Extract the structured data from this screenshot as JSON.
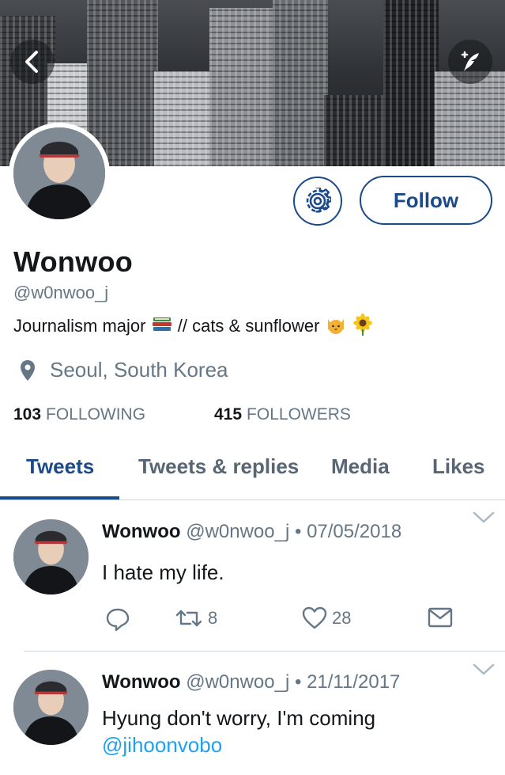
{
  "header": {
    "back_icon": "chevron-left-icon",
    "compose_icon": "compose-quill-icon"
  },
  "profile": {
    "name": "Wonwoo",
    "handle": "@w0nwoo_j",
    "bio_part1": "Journalism major",
    "bio_part2": " // cats & sunflower",
    "location": "Seoul, South Korea",
    "following_count": "103",
    "following_label": "FOLLOWING",
    "followers_count": "415",
    "followers_label": "FOLLOWERS",
    "follow_label": "Follow"
  },
  "tabs": [
    {
      "label": "Tweets",
      "active": true
    },
    {
      "label": "Tweets & replies",
      "active": false
    },
    {
      "label": "Media",
      "active": false
    },
    {
      "label": "Likes",
      "active": false
    }
  ],
  "tweets": [
    {
      "name": "Wonwoo",
      "handle": "@w0nwoo_j",
      "date": "07/05/2018",
      "text": "I hate my life.",
      "retweets": "8",
      "likes": "28"
    },
    {
      "name": "Wonwoo",
      "handle": "@w0nwoo_j",
      "date": "21/11/2017",
      "text": "Hyung don't worry, I'm coming",
      "mention": "@jihoonvobo"
    }
  ],
  "colors": {
    "accent": "#1b4a8a",
    "secondary_text": "#657786",
    "link": "#1da1f2"
  }
}
